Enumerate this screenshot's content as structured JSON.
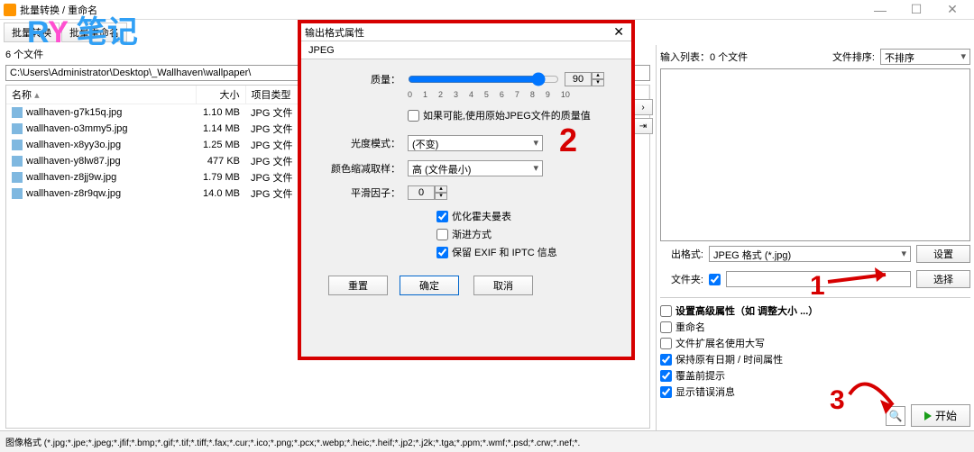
{
  "window": {
    "title": "批量转换 / 重命名"
  },
  "winbtns": {
    "min": "—",
    "max": "☐",
    "close": "✕"
  },
  "toolbar": {
    "convert": "批量转换",
    "rename": "批量重命名"
  },
  "watermark": {
    "r": "R",
    "y": "Y",
    "cj": "笔记"
  },
  "leftpane": {
    "count": "6 个文件",
    "path": "C:\\Users\\Administrator\\Desktop\\_Wallhaven\\wallpaper\\",
    "cols": {
      "name": "名称",
      "size": "大小",
      "type": "项目类型"
    },
    "rows": [
      {
        "name": "wallhaven-g7k15q.jpg",
        "size": "1.10 MB",
        "type": "JPG 文件"
      },
      {
        "name": "wallhaven-o3mmy5.jpg",
        "size": "1.14 MB",
        "type": "JPG 文件"
      },
      {
        "name": "wallhaven-x8yy3o.jpg",
        "size": "1.25 MB",
        "type": "JPG 文件"
      },
      {
        "name": "wallhaven-y8lw87.jpg",
        "size": "477 KB",
        "type": "JPG 文件"
      },
      {
        "name": "wallhaven-z8jj9w.jpg",
        "size": "1.79 MB",
        "type": "JPG 文件"
      },
      {
        "name": "wallhaven-z8r9qw.jpg",
        "size": "14.0 MB",
        "type": "JPG 文件"
      }
    ]
  },
  "rightpane": {
    "inputlist": "输入列表：0 个文件",
    "sortlabel": "文件排序:",
    "sortvalue": "不排序",
    "format_label": "出格式:",
    "format_value": "JPEG 格式 (*.jpg)",
    "settings_btn": "设置",
    "folder_label": "文件夹:",
    "folder_value": "",
    "browse_btn": "选择",
    "adv_label": "设置高级属性（如 调整大小 ...）",
    "opt_rename": "重命名",
    "opt_upperext": "文件扩展名使用大写",
    "opt_keepdate": "保持原有日期 / 时间属性",
    "opt_overwrite": "覆盖前提示",
    "opt_showerr": "显示错误消息",
    "start_btn": "开始"
  },
  "dialog": {
    "title": "输出格式属性",
    "tab": "JPEG",
    "quality_label": "质量：",
    "quality_value": "90",
    "ticks": [
      "0",
      "1",
      "2",
      "3",
      "4",
      "5",
      "6",
      "7",
      "8",
      "9",
      "10"
    ],
    "use_orig": "如果可能,使用原始JPEG文件的质量值",
    "gray_label": "光度模式：",
    "gray_value": "(不变)",
    "subsample_label": "颜色缩减取样：",
    "subsample_value": "高 (文件最小)",
    "smooth_label": "平滑因子：",
    "smooth_value": "0",
    "opt_huff": "优化霍夫曼表",
    "opt_prog": "渐进方式",
    "opt_exif": "保留 EXIF 和 IPTC 信息",
    "reset": "重置",
    "ok": "确定",
    "cancel": "取消"
  },
  "annotations": {
    "a1": "1",
    "a2": "2",
    "a3": "3"
  },
  "footer": {
    "formats": "图像格式 (*.jpg;*.jpe;*.jpeg;*.jfif;*.bmp;*.gif;*.tif;*.tiff;*.fax;*.cur;*.ico;*.png;*.pcx;*.webp;*.heic;*.heif;*.jp2;*.j2k;*.tga;*.ppm;*.wmf;*.psd;*.crw;*.nef;*."
  }
}
